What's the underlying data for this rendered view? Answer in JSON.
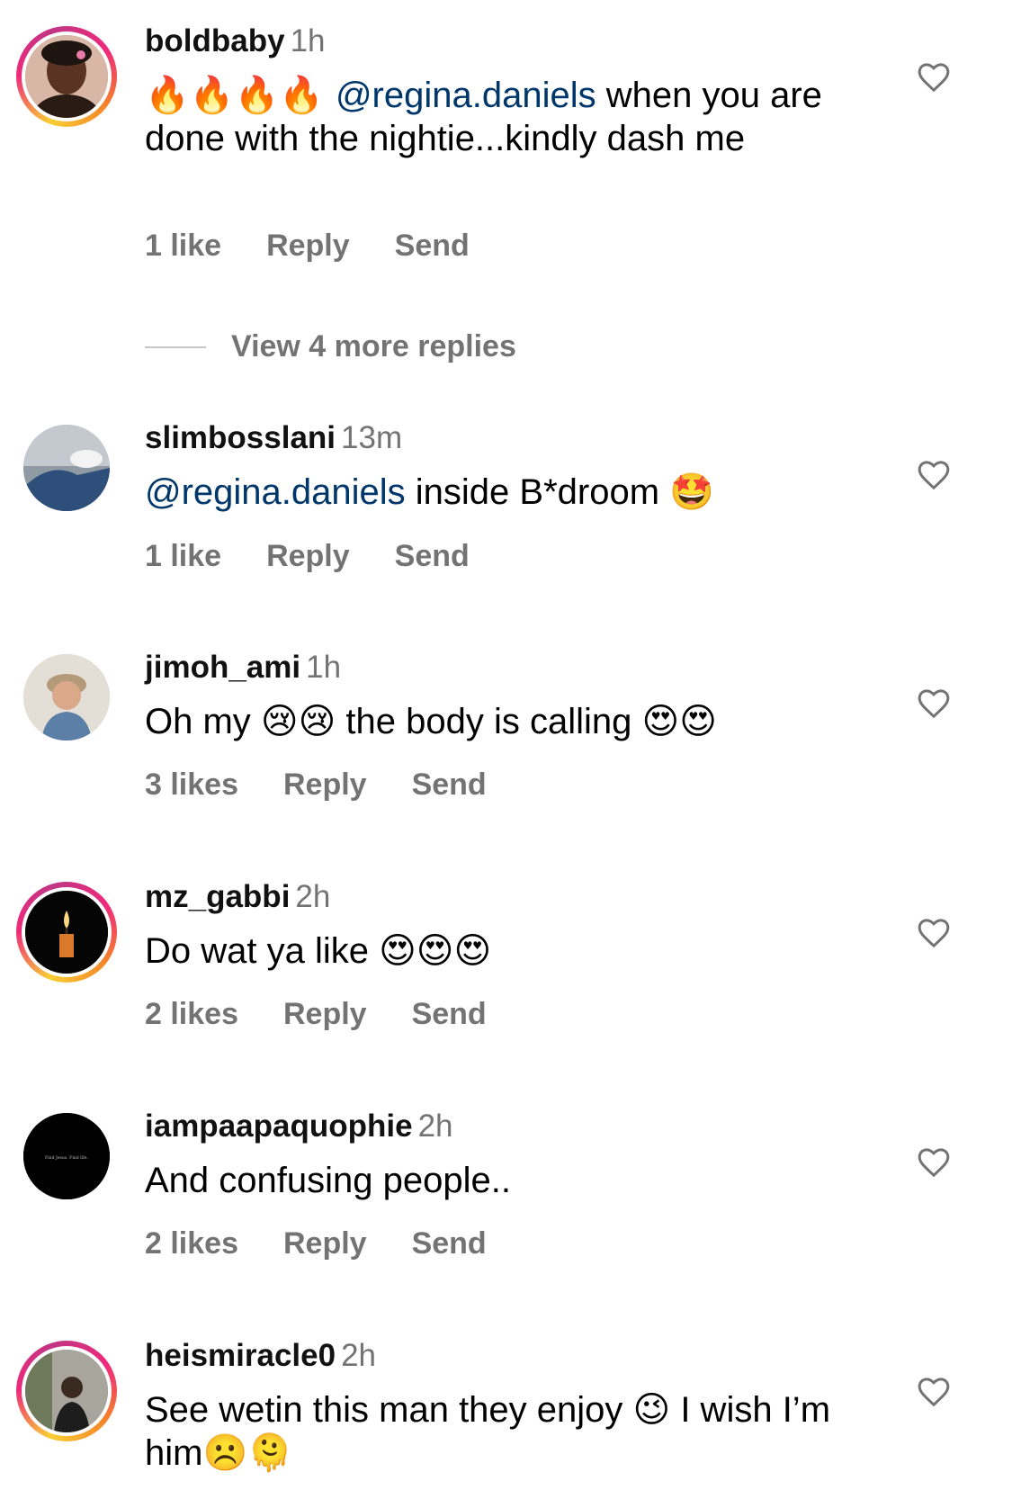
{
  "comments": [
    {
      "username": "boldbaby",
      "time": "1h",
      "text_parts": [
        "🔥🔥🔥🔥 ",
        "@regina.daniels",
        " when you are done with the nightie...kindly dash me"
      ],
      "likes": "1 like",
      "reply": "Reply",
      "send": "Send"
    },
    {
      "username": "slimbosslani",
      "time": "13m",
      "text_parts": [
        "",
        "@regina.daniels",
        " inside B*droom 🤩"
      ],
      "likes": "1 like",
      "reply": "Reply",
      "send": "Send"
    },
    {
      "username": "jimoh_ami",
      "time": "1h",
      "text": "Oh my 😢😢 the body is calling 😍😍",
      "likes": "3 likes",
      "reply": "Reply",
      "send": "Send"
    },
    {
      "username": "mz_gabbi",
      "time": "2h",
      "text": "Do wat ya like 😍😍😍",
      "likes": "2 likes",
      "reply": "Reply",
      "send": "Send"
    },
    {
      "username": "iampaapaquophie",
      "time": "2h",
      "text": "And confusing people..",
      "likes": "2 likes",
      "reply": "Reply",
      "send": "Send"
    },
    {
      "username": "heismiracle0",
      "time": "2h",
      "text": "See wetin this man they enjoy 😉 I wish I’m him☹️🫠"
    }
  ],
  "view_more_replies": "View 4 more replies",
  "avatar_text": "Find Jesus. Find life.",
  "icons": {
    "like": "heart-outline-icon"
  },
  "colors": {
    "mention": "#00376b",
    "secondary_text": "#737373",
    "story_ring": [
      "#f9ce34",
      "#ee2a7b",
      "#c13584"
    ]
  }
}
